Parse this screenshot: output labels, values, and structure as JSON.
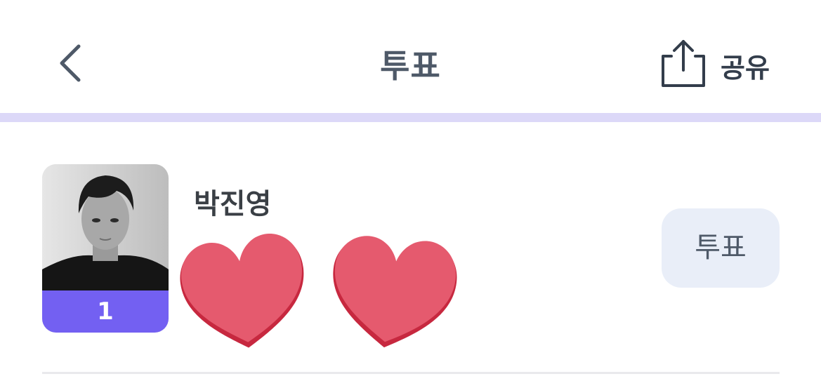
{
  "header": {
    "title": "투표",
    "share_label": "공유"
  },
  "colors": {
    "accent_purple": "#7360f2",
    "divider_lavender": "#dcd8f8",
    "heart_red": "#e55a6e",
    "vote_button_bg": "#e9eef8"
  },
  "candidate": {
    "name": "박진영",
    "rank": "1",
    "vote_label": "투표"
  }
}
